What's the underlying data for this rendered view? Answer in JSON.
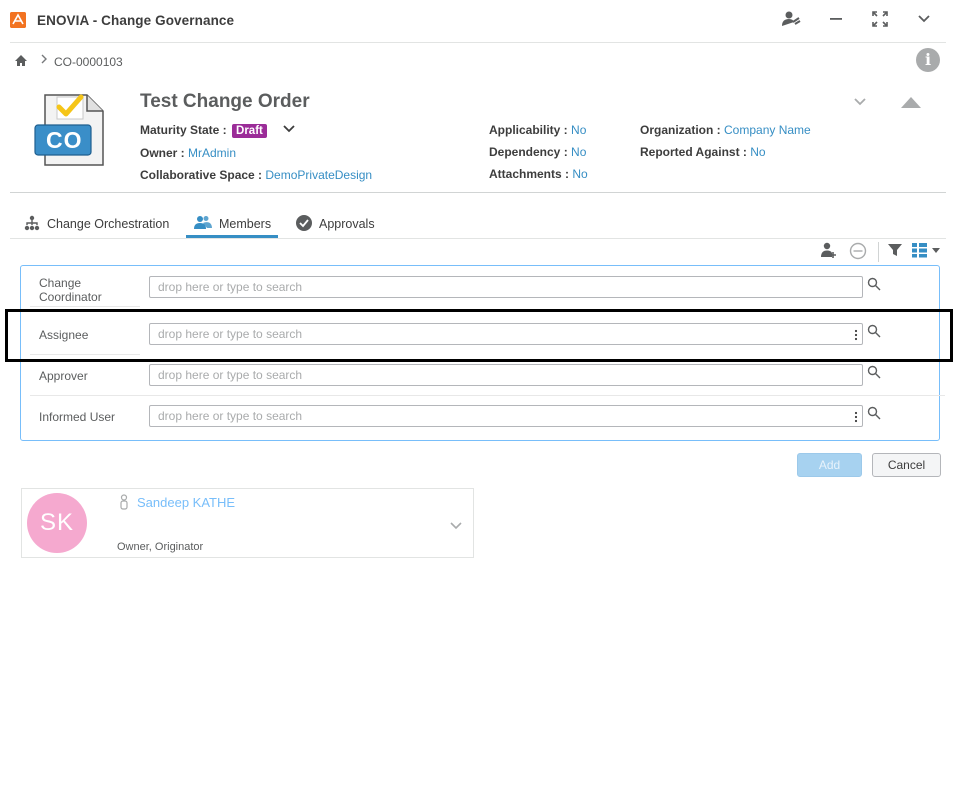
{
  "app": {
    "logo_glyph": "3DS",
    "title": "ENOVIA - Change Governance"
  },
  "breadcrumb": {
    "current": "CO-0000103"
  },
  "header": {
    "icon_label": "CO",
    "title": "Test Change Order",
    "maturity_state_label": "Maturity State :",
    "maturity_state_value": "Draft",
    "owner_label": "Owner :",
    "owner_value": "MrAdmin",
    "collab_space_label": "Collaborative Space :",
    "collab_space_value": "DemoPrivateDesign",
    "applicability_label": "Applicability :",
    "applicability_value": "No",
    "dependency_label": "Dependency :",
    "dependency_value": "No",
    "attachments_label": "Attachments :",
    "attachments_value": "No",
    "organization_label": "Organization :",
    "organization_value": "Company Name",
    "reported_against_label": "Reported Against :",
    "reported_against_value": "No"
  },
  "tabs": [
    {
      "label": "Change Orchestration",
      "icon": "hierarchy-icon",
      "active": false
    },
    {
      "label": "Members",
      "icon": "members-icon",
      "active": true
    },
    {
      "label": "Approvals",
      "icon": "check-circle-icon",
      "active": false
    }
  ],
  "members_form": {
    "rows": [
      {
        "label_line1": "Change",
        "label_line2": "Coordinator",
        "placeholder": "drop here or type to search"
      },
      {
        "label": "Assignee",
        "placeholder": "drop here or type to search"
      },
      {
        "label": "Approver",
        "placeholder": "drop here or type to search"
      },
      {
        "label": "Informed User",
        "placeholder": "drop here or type to search"
      }
    ]
  },
  "buttons": {
    "add": "Add",
    "cancel": "Cancel"
  },
  "member_card": {
    "initials": "SK",
    "name": "Sandeep KATHE",
    "roles": "Owner, Originator",
    "avatar_color": "#f5a9cf"
  },
  "colors": {
    "accent": "#368ec4",
    "draft_badge": "#9b2c98",
    "brand_logo": "#f27321"
  }
}
